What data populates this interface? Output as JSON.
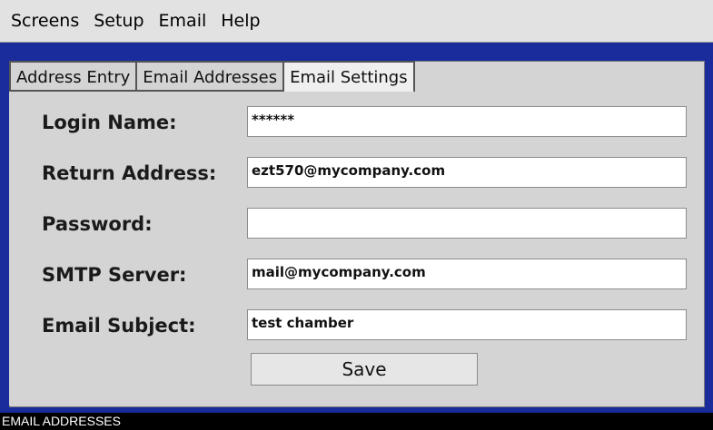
{
  "menubar": {
    "items": [
      "Screens",
      "Setup",
      "Email",
      "Help"
    ]
  },
  "tabs": [
    {
      "label": "Address Entry",
      "active": false
    },
    {
      "label": "Email Addresses",
      "active": false
    },
    {
      "label": "Email Settings",
      "active": true
    }
  ],
  "form": {
    "login_name": {
      "label": "Login Name:",
      "value": "******"
    },
    "return_address": {
      "label": "Return Address:",
      "value": "ezt570@mycompany.com"
    },
    "password": {
      "label": "Password:",
      "value": ""
    },
    "smtp_server": {
      "label": "SMTP Server:",
      "value": "mail@mycompany.com"
    },
    "email_subject": {
      "label": "Email Subject:",
      "value": "test chamber"
    }
  },
  "save_label": "Save",
  "status": "EMAIL ADDRESSES",
  "colors": {
    "frame": "#1a2b9c",
    "panel": "#d4d4d4",
    "menubar": "#e2e2e2",
    "statusbar": "#000000"
  }
}
